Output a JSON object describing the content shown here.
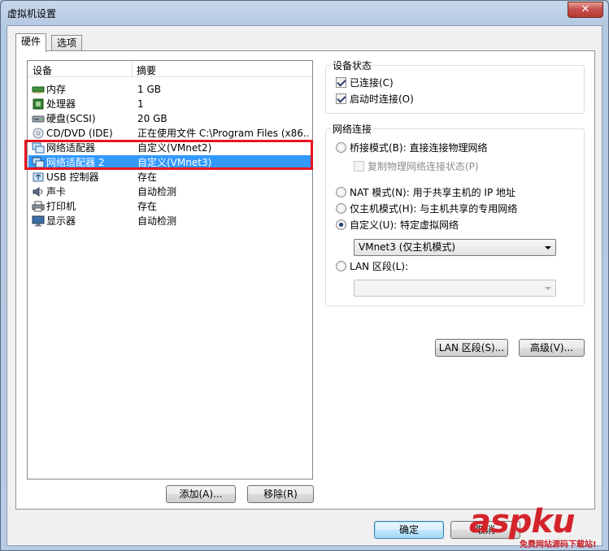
{
  "window": {
    "title": "虚拟机设置",
    "close_label": "✕"
  },
  "tabs": [
    {
      "label": "硬件",
      "active": true
    },
    {
      "label": "选项",
      "active": false
    }
  ],
  "device_list": {
    "columns": [
      "设备",
      "摘要"
    ],
    "rows": [
      {
        "name": "内存",
        "summary": "1 GB",
        "icon": "memory-icon"
      },
      {
        "name": "处理器",
        "summary": "1",
        "icon": "processor-icon"
      },
      {
        "name": "硬盘(SCSI)",
        "summary": "20 GB",
        "icon": "harddisk-icon"
      },
      {
        "name": "CD/DVD (IDE)",
        "summary": "正在使用文件 C:\\Program Files (x86...",
        "icon": "cdrom-icon"
      },
      {
        "name": "网络适配器",
        "summary": "自定义(VMnet2)",
        "icon": "network-adapter-icon"
      },
      {
        "name": "网络适配器 2",
        "summary": "自定义(VMnet3)",
        "icon": "network-adapter-icon",
        "selected": true
      },
      {
        "name": "USB 控制器",
        "summary": "存在",
        "icon": "usb-icon"
      },
      {
        "name": "声卡",
        "summary": "自动检测",
        "icon": "sound-icon"
      },
      {
        "name": "打印机",
        "summary": "存在",
        "icon": "printer-icon"
      },
      {
        "name": "显示器",
        "summary": "自动检测",
        "icon": "display-icon"
      }
    ],
    "add_button": "添加(A)...",
    "remove_button": "移除(R)"
  },
  "device_status": {
    "title": "设备状态",
    "connected": {
      "label": "已连接(C)",
      "checked": true
    },
    "connect_on_power_on": {
      "label": "启动时连接(O)",
      "checked": true
    }
  },
  "network_connection": {
    "title": "网络连接",
    "bridged": {
      "label": "桥接模式(B): 直接连接物理网络",
      "checked": false
    },
    "replicate": {
      "label": "复制物理网络连接状态(P)",
      "checked": false,
      "disabled": true
    },
    "nat": {
      "label": "NAT 模式(N): 用于共享主机的 IP 地址",
      "checked": false
    },
    "host_only": {
      "label": "仅主机模式(H): 与主机共享的专用网络",
      "checked": false
    },
    "custom": {
      "label": "自定义(U): 特定虚拟网络",
      "checked": true
    },
    "custom_select": "VMnet3 (仅主机模式)",
    "lan": {
      "label": "LAN 区段(L):",
      "checked": false
    },
    "lan_select": ""
  },
  "buttons": {
    "lan_segments": "LAN 区段(S)...",
    "advanced": "高级(V)...",
    "ok": "确定",
    "cancel": "取消"
  },
  "watermark": {
    "brand": "aspku",
    "tagline": "免费网站源码下载站!"
  }
}
